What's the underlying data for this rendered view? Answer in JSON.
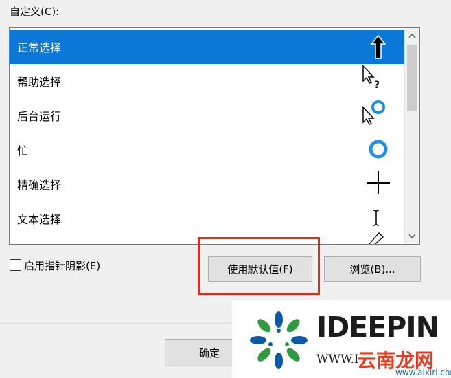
{
  "dialog": {
    "custom_label": "自定义(C):"
  },
  "cursor_list": {
    "items": [
      {
        "label": "正常选择",
        "icon": "normal-select-arrow-icon",
        "selected": true
      },
      {
        "label": "帮助选择",
        "icon": "help-select-cursor-icon",
        "selected": false
      },
      {
        "label": "后台运行",
        "icon": "working-in-background-cursor-icon",
        "selected": false
      },
      {
        "label": "忙",
        "icon": "busy-ring-icon",
        "selected": false
      },
      {
        "label": "精确选择",
        "icon": "precision-crosshair-icon",
        "selected": false
      },
      {
        "label": "文本选择",
        "icon": "text-ibeam-icon",
        "selected": false
      }
    ]
  },
  "options": {
    "pointer_shadow_label": "启用指针阴影(E)",
    "pointer_shadow_checked": false
  },
  "buttons": {
    "use_default": "使用默认值(F)",
    "browse": "浏览(B)...",
    "ok": "确定"
  },
  "watermark": {
    "brand": "IDEEPIN",
    "url": "WWW.I",
    "cn_text": "云南龙网",
    "url2": "www.aixiri.com"
  },
  "colors": {
    "selection": "#0b78d7",
    "highlight_box": "#e02a20",
    "ring_blue": "#1e90e6"
  }
}
